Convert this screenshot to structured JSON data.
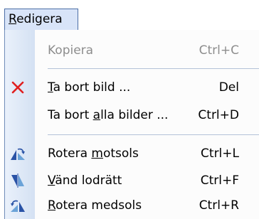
{
  "menu": {
    "title_first": "R",
    "title_rest": "edigera"
  },
  "items": [
    {
      "label": "Kopiera",
      "shortcut": "Ctrl+C",
      "disabled": true,
      "icon": null
    },
    {
      "label_pre": "",
      "label_u": "T",
      "label_post": "a bort bild ...",
      "shortcut": "Del",
      "icon": "delete-x-icon"
    },
    {
      "label_pre": "Ta bort ",
      "label_u": "a",
      "label_post": "lla bilder ...",
      "shortcut": "Ctrl+D",
      "icon": null
    },
    {
      "label_pre": "Rotera ",
      "label_u": "m",
      "label_post": "otsols",
      "shortcut": "Ctrl+L",
      "icon": "rotate-left-icon"
    },
    {
      "label_pre": "",
      "label_u": "V",
      "label_post": "änd lodrätt",
      "shortcut": "Ctrl+F",
      "icon": "flip-vertical-icon"
    },
    {
      "label_pre": "",
      "label_u": "R",
      "label_post": "otera medsols",
      "shortcut": "Ctrl+R",
      "icon": "rotate-right-icon"
    }
  ],
  "colors": {
    "menu_highlight": "#d8e4f8",
    "menu_border": "#4c6ea6",
    "gutter": "#dbe6f5",
    "disabled_text": "#8d8d8d",
    "delete_icon": "#e02020",
    "icon_primary": "#2a53a6",
    "icon_secondary": "#6ba3d8"
  }
}
